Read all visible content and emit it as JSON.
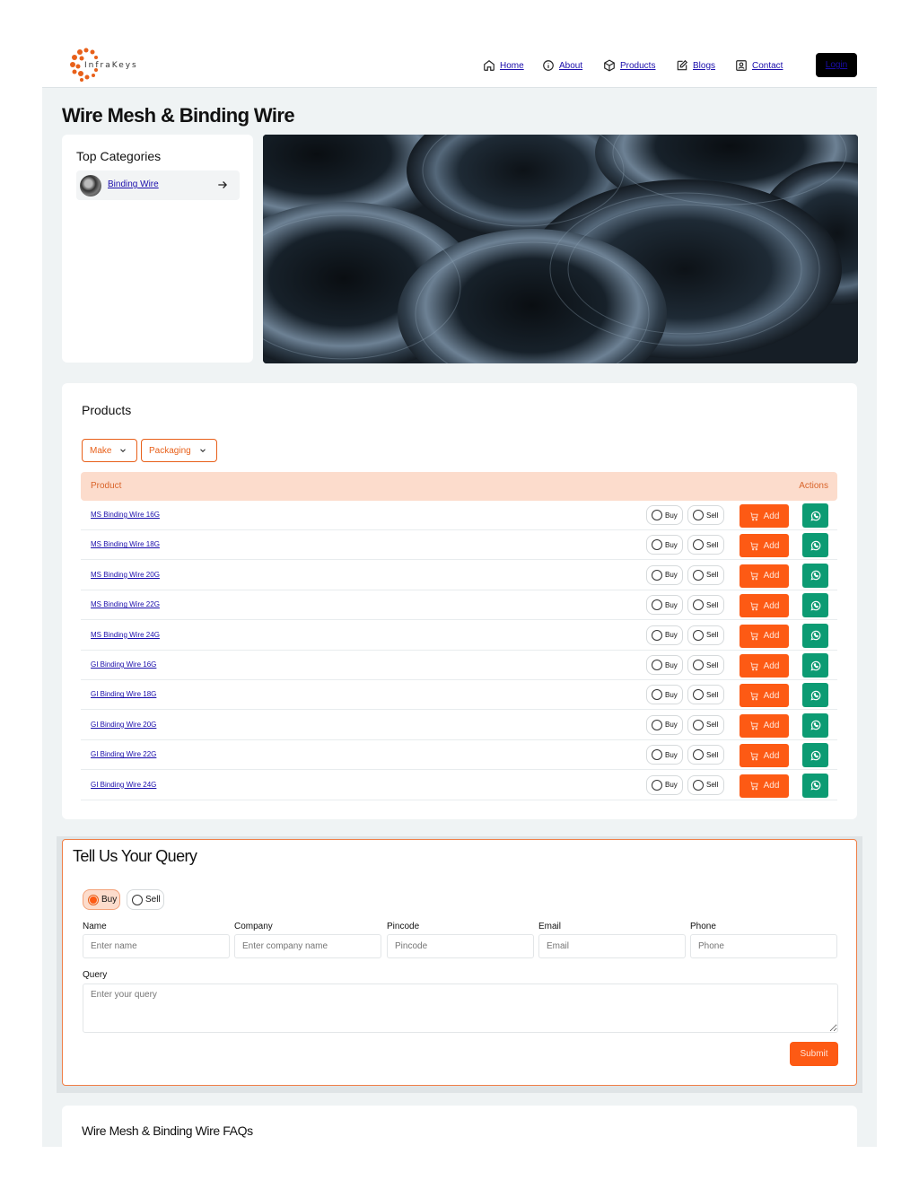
{
  "brand": {
    "logo_text": "InfraKeys",
    "accent": "#fd5a14",
    "whatsapp_color": "#0c9b73"
  },
  "nav": {
    "items": [
      {
        "label": "Home",
        "icon": "home-icon"
      },
      {
        "label": "About",
        "icon": "info-icon"
      },
      {
        "label": "Products",
        "icon": "box-icon"
      },
      {
        "label": "Blogs",
        "icon": "edit-icon"
      },
      {
        "label": "Contact",
        "icon": "contact-icon"
      }
    ],
    "login_label": "Login"
  },
  "page": {
    "title": "Wire Mesh & Binding Wire"
  },
  "top_categories": {
    "heading": "Top Categories",
    "items": [
      {
        "label": "Binding Wire",
        "icon": "arrow-right-icon"
      }
    ]
  },
  "products": {
    "heading": "Products",
    "filters": [
      {
        "label": "Make"
      },
      {
        "label": "Packaging"
      }
    ],
    "columns": {
      "product": "Product",
      "actions": "Actions"
    },
    "buy_label": "Buy",
    "sell_label": "Sell",
    "add_label": "Add",
    "rows": [
      {
        "name": "MS Binding Wire 16G"
      },
      {
        "name": "MS Binding Wire 18G"
      },
      {
        "name": "MS Binding Wire 20G"
      },
      {
        "name": "MS Binding Wire 22G"
      },
      {
        "name": "MS Binding Wire 24G"
      },
      {
        "name": "GI Binding Wire 16G"
      },
      {
        "name": "GI Binding Wire 18G"
      },
      {
        "name": "GI Binding Wire 20G"
      },
      {
        "name": "GI Binding Wire 22G"
      },
      {
        "name": "GI Binding Wire 24G"
      }
    ]
  },
  "query_form": {
    "heading": "Tell Us Your Query",
    "options": {
      "buy": "Buy",
      "sell": "Sell",
      "selected": "Buy"
    },
    "fields": {
      "name": {
        "label": "Name",
        "placeholder": "Enter name"
      },
      "company": {
        "label": "Company",
        "placeholder": "Enter company name"
      },
      "pincode": {
        "label": "Pincode",
        "placeholder": "Pincode"
      },
      "email": {
        "label": "Email",
        "placeholder": "Email"
      },
      "phone": {
        "label": "Phone",
        "placeholder": "Phone"
      }
    },
    "query": {
      "label": "Query",
      "placeholder": "Enter your query"
    },
    "submit_label": "Submit"
  },
  "faq": {
    "heading": "Wire Mesh & Binding Wire FAQs"
  }
}
